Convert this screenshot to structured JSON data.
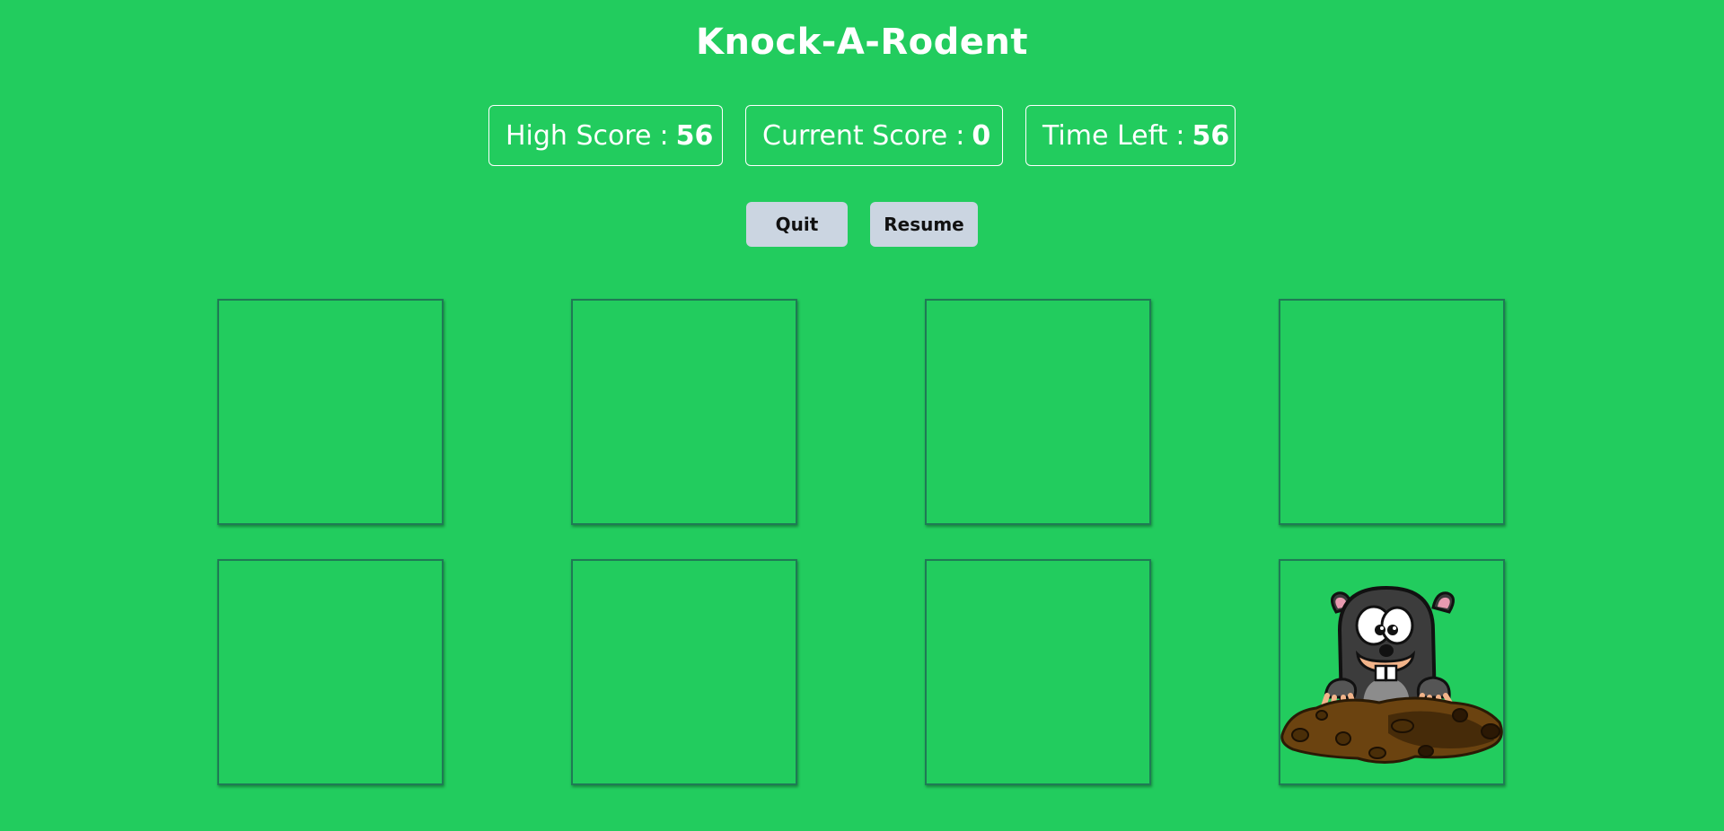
{
  "game": {
    "title": "Knock-A-Rodent"
  },
  "stats": {
    "high_score": {
      "label": "High Score",
      "separator": ":",
      "value": "56"
    },
    "current_score": {
      "label": "Current Score",
      "separator": ":",
      "value": "0"
    },
    "time_left": {
      "label": "Time Left",
      "separator": ":",
      "value": "56"
    }
  },
  "controls": {
    "quit_label": "Quit",
    "resume_label": "Resume"
  },
  "board": {
    "rows": 2,
    "columns": 4,
    "mole_hole_index": 7,
    "holes": [
      {
        "index": 0,
        "has_mole": false
      },
      {
        "index": 1,
        "has_mole": false
      },
      {
        "index": 2,
        "has_mole": false
      },
      {
        "index": 3,
        "has_mole": false
      },
      {
        "index": 4,
        "has_mole": false
      },
      {
        "index": 5,
        "has_mole": false
      },
      {
        "index": 6,
        "has_mole": false
      },
      {
        "index": 7,
        "has_mole": true
      }
    ]
  },
  "colors": {
    "background": "#22cc5e",
    "button": "#cbd5e1",
    "hole_border": "#1f7a55",
    "text": "#ffffff"
  }
}
